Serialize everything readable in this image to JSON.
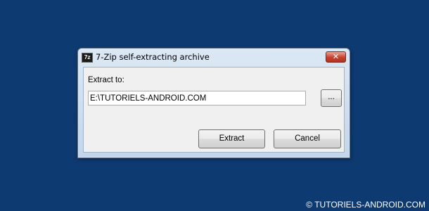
{
  "window": {
    "title": "7-Zip self-extracting archive",
    "icon_text": "7z",
    "close_symbol": "✕"
  },
  "dialog": {
    "extract_to_label": "Extract to:",
    "path_value": "E:\\TUTORIELS-ANDROID.COM",
    "browse_label": "...",
    "extract_label": "Extract",
    "cancel_label": "Cancel"
  },
  "watermark": "© TUTORIELS-ANDROID.COM",
  "colors": {
    "desktop": "#0e3a72",
    "dialog_face": "#f0f0f0",
    "close_button": "#c8412c"
  }
}
